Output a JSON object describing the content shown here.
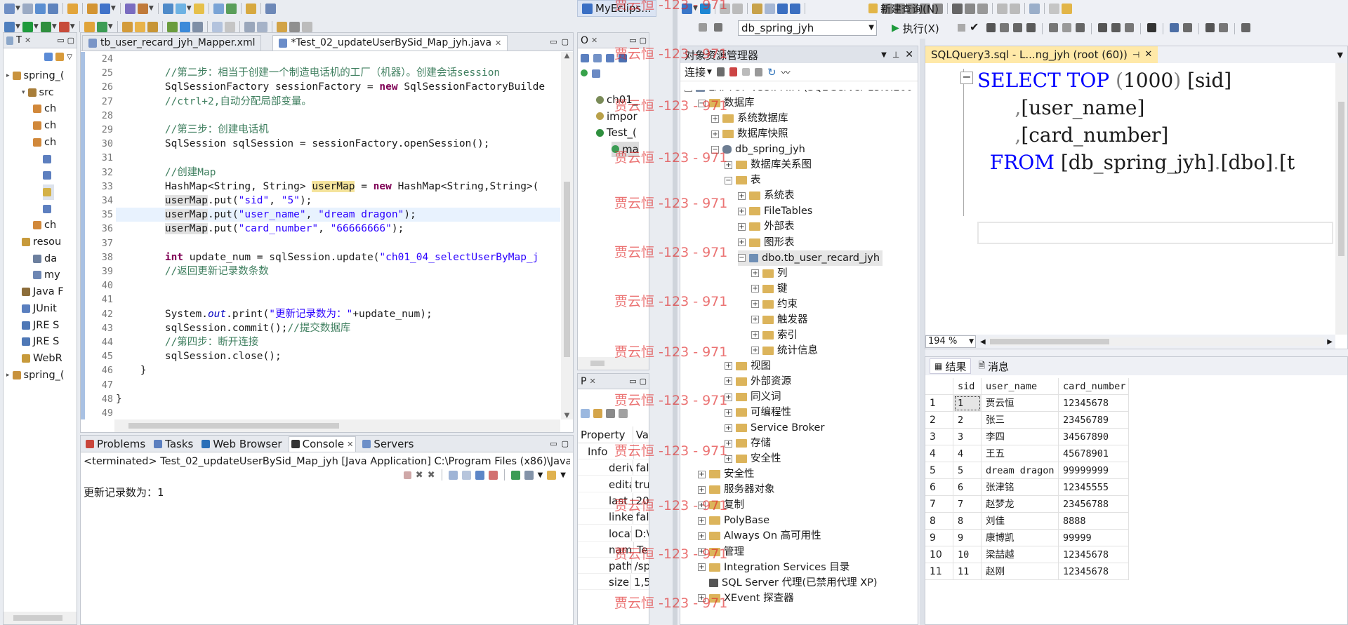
{
  "eclipse": {
    "perspective_label": "MyEclips...",
    "editor_tabs": [
      {
        "label": "tb_user_recard_jyh_Mapper.xml"
      },
      {
        "label": "*Test_02_updateUserBySid_Map_jyh.java"
      }
    ],
    "explorer_tab": "T",
    "explorer_items": [
      "spring_(",
      "src",
      "ch",
      "ch",
      "ch",
      "",
      "",
      "",
      "",
      "ch",
      "resou",
      "da",
      "my",
      "Java F",
      "JUnit",
      "JRE S",
      "JRE S",
      "WebR",
      "spring_("
    ],
    "outline_tab": "O",
    "outline_items": [
      "ch01_",
      "impor",
      "Test_(",
      "ma"
    ],
    "props_tab": "P",
    "props_header": {
      "k": "Property",
      "v": "Va"
    },
    "props_rows": [
      {
        "k": "Info",
        "v": ""
      },
      {
        "k": "deriv",
        "v": "fal"
      },
      {
        "k": "edita",
        "v": "tru"
      },
      {
        "k": "last r",
        "v": "20"
      },
      {
        "k": "linke",
        "v": "fal"
      },
      {
        "k": "locat",
        "v": "D:\\"
      },
      {
        "k": "nam",
        "v": "Te"
      },
      {
        "k": "path",
        "v": "/sp"
      },
      {
        "k": "size",
        "v": "1,5"
      }
    ],
    "code": {
      "line_numbers": [
        "24",
        "25",
        "26",
        "27",
        "28",
        "29",
        "30",
        "31",
        "32",
        "33",
        "34",
        "35",
        "36",
        "37",
        "38",
        "39",
        "40",
        "41",
        "42",
        "43",
        "44",
        "45",
        "46",
        "47",
        "48",
        "49"
      ],
      "lines": [
        [],
        [
          {
            "t": "        //第二步：相当于创建一个制造电话机的工厂（机器）。创建会话session",
            "c": "cm"
          }
        ],
        [
          {
            "t": "        SqlSessionFactory sessionFactory = ",
            "c": ""
          },
          {
            "t": "new",
            "c": "kw"
          },
          {
            "t": " SqlSessionFactoryBuilde",
            "c": ""
          }
        ],
        [
          {
            "t": "        //ctrl+2,自动分配局部变量。",
            "c": "cm"
          }
        ],
        [],
        [
          {
            "t": "        //第三步：创建电话机",
            "c": "cm"
          }
        ],
        [
          {
            "t": "        SqlSession sqlSession = sessionFactory.openSession();",
            "c": ""
          }
        ],
        [],
        [
          {
            "t": "        //创建Map",
            "c": "cm"
          }
        ],
        [
          {
            "t": "        HashMap<String, String> ",
            "c": ""
          },
          {
            "t": "userMap",
            "c": "hl"
          },
          {
            "t": " = ",
            "c": ""
          },
          {
            "t": "new",
            "c": "kw"
          },
          {
            "t": " HashMap<String,String>(",
            "c": ""
          }
        ],
        [
          {
            "t": "        ",
            "c": ""
          },
          {
            "t": "userMap",
            "c": "hl2"
          },
          {
            "t": ".put(",
            "c": ""
          },
          {
            "t": "\"sid\"",
            "c": "str"
          },
          {
            "t": ", ",
            "c": ""
          },
          {
            "t": "\"5\"",
            "c": "str"
          },
          {
            "t": ");",
            "c": ""
          }
        ],
        [
          {
            "t": "        ",
            "c": ""
          },
          {
            "t": "userMap",
            "c": "hl2"
          },
          {
            "t": ".put(",
            "c": ""
          },
          {
            "t": "\"user_name\"",
            "c": "str"
          },
          {
            "t": ", ",
            "c": ""
          },
          {
            "t": "\"dream dragon\"",
            "c": "str"
          },
          {
            "t": ");",
            "c": ""
          }
        ],
        [
          {
            "t": "        ",
            "c": ""
          },
          {
            "t": "userMap",
            "c": "hl2"
          },
          {
            "t": ".put(",
            "c": ""
          },
          {
            "t": "\"card_number\"",
            "c": "str"
          },
          {
            "t": ", ",
            "c": ""
          },
          {
            "t": "\"66666666\"",
            "c": "str"
          },
          {
            "t": ");",
            "c": ""
          }
        ],
        [],
        [
          {
            "t": "        ",
            "c": ""
          },
          {
            "t": "int",
            "c": "kw"
          },
          {
            "t": " update_num = sqlSession.update(",
            "c": ""
          },
          {
            "t": "\"ch01_04_selectUserByMap_j",
            "c": "str"
          }
        ],
        [
          {
            "t": "        //返回更新记录数条数",
            "c": "cm"
          }
        ],
        [],
        [],
        [
          {
            "t": "        System.",
            "c": ""
          },
          {
            "t": "out",
            "c": "it"
          },
          {
            "t": ".print(",
            "c": ""
          },
          {
            "t": "\"更新记录数为：\"",
            "c": "str"
          },
          {
            "t": "+update_num);",
            "c": ""
          }
        ],
        [
          {
            "t": "        sqlSession.commit();",
            "c": ""
          },
          {
            "t": "//提交数据库",
            "c": "cm"
          }
        ],
        [
          {
            "t": "        //第四步：断开连接",
            "c": "cm"
          }
        ],
        [
          {
            "t": "        sqlSession.close();",
            "c": ""
          }
        ],
        [
          {
            "t": "    }",
            "c": ""
          }
        ],
        [],
        [
          {
            "t": "}",
            "c": ""
          }
        ],
        []
      ]
    },
    "bottom_tabs": [
      "Problems",
      "Tasks",
      "Web Browser",
      "Console",
      "Servers"
    ],
    "console_header": "<terminated> Test_02_updateUserBySid_Map_jyh [Java Application] C:\\Program Files (x86)\\Java\\",
    "console_output": "更新记录数为：1"
  },
  "ssms": {
    "db_combo": "db_spring_jyh",
    "execute_label": "执行(X)",
    "new_query_label": "新建查询(N)",
    "explorer_title": "对象资源管理器",
    "connect_label": "连接",
    "query_tab": "SQLQuery3.sql - L...ng_jyh (root (60))",
    "tree": [
      {
        "label": "LAPTOP-V55IPMIM (SQL Server 15.0.200",
        "lvl": 0,
        "sign": "−",
        "icon": "server"
      },
      {
        "label": "数据库",
        "lvl": 1,
        "sign": "−",
        "icon": "folder"
      },
      {
        "label": "系统数据库",
        "lvl": 2,
        "sign": "+",
        "icon": "folder"
      },
      {
        "label": "数据库快照",
        "lvl": 2,
        "sign": "+",
        "icon": "folder"
      },
      {
        "label": "db_spring_jyh",
        "lvl": 2,
        "sign": "−",
        "icon": "db"
      },
      {
        "label": "数据库关系图",
        "lvl": 3,
        "sign": "+",
        "icon": "folder"
      },
      {
        "label": "表",
        "lvl": 3,
        "sign": "−",
        "icon": "folder"
      },
      {
        "label": "系统表",
        "lvl": 4,
        "sign": "+",
        "icon": "folder"
      },
      {
        "label": "FileTables",
        "lvl": 4,
        "sign": "+",
        "icon": "folder"
      },
      {
        "label": "外部表",
        "lvl": 4,
        "sign": "+",
        "icon": "folder"
      },
      {
        "label": "图形表",
        "lvl": 4,
        "sign": "+",
        "icon": "folder"
      },
      {
        "label": "dbo.tb_user_recard_jyh",
        "lvl": 4,
        "sign": "−",
        "icon": "table"
      },
      {
        "label": "列",
        "lvl": 5,
        "sign": "+",
        "icon": "folder"
      },
      {
        "label": "键",
        "lvl": 5,
        "sign": "+",
        "icon": "folder"
      },
      {
        "label": "约束",
        "lvl": 5,
        "sign": "+",
        "icon": "folder"
      },
      {
        "label": "触发器",
        "lvl": 5,
        "sign": "+",
        "icon": "folder"
      },
      {
        "label": "索引",
        "lvl": 5,
        "sign": "+",
        "icon": "folder"
      },
      {
        "label": "统计信息",
        "lvl": 5,
        "sign": "+",
        "icon": "folder"
      },
      {
        "label": "视图",
        "lvl": 3,
        "sign": "+",
        "icon": "folder"
      },
      {
        "label": "外部资源",
        "lvl": 3,
        "sign": "+",
        "icon": "folder"
      },
      {
        "label": "同义词",
        "lvl": 3,
        "sign": "+",
        "icon": "folder"
      },
      {
        "label": "可编程性",
        "lvl": 3,
        "sign": "+",
        "icon": "folder"
      },
      {
        "label": "Service Broker",
        "lvl": 3,
        "sign": "+",
        "icon": "folder"
      },
      {
        "label": "存储",
        "lvl": 3,
        "sign": "+",
        "icon": "folder"
      },
      {
        "label": "安全性",
        "lvl": 3,
        "sign": "+",
        "icon": "folder"
      },
      {
        "label": "安全性",
        "lvl": 1,
        "sign": "+",
        "icon": "folder"
      },
      {
        "label": "服务器对象",
        "lvl": 1,
        "sign": "+",
        "icon": "folder"
      },
      {
        "label": "复制",
        "lvl": 1,
        "sign": "+",
        "icon": "folder"
      },
      {
        "label": "PolyBase",
        "lvl": 1,
        "sign": "+",
        "icon": "folder"
      },
      {
        "label": "Always On 高可用性",
        "lvl": 1,
        "sign": "+",
        "icon": "folder"
      },
      {
        "label": "管理",
        "lvl": 1,
        "sign": "+",
        "icon": "folder"
      },
      {
        "label": "Integration Services 目录",
        "lvl": 1,
        "sign": "+",
        "icon": "folder"
      },
      {
        "label": "SQL Server 代理(已禁用代理 XP)",
        "lvl": 1,
        "sign": "",
        "icon": "agent"
      },
      {
        "label": "XEvent 探查器",
        "lvl": 1,
        "sign": "+",
        "icon": "folder"
      }
    ],
    "sql_lines": [
      [
        {
          "t": "SELECT TOP ",
          "c": "sqlkw"
        },
        {
          "t": "(",
          "c": "sqlg"
        },
        {
          "t": "1000",
          "c": ""
        },
        {
          "t": ")",
          "c": "sqlg"
        },
        {
          "t": " [sid]",
          "c": ""
        }
      ],
      [
        {
          "t": "      ,",
          "c": "sqlg"
        },
        {
          "t": "[user_name]",
          "c": ""
        }
      ],
      [
        {
          "t": "      ,",
          "c": "sqlg"
        },
        {
          "t": "[card_number]",
          "c": ""
        }
      ],
      [
        {
          "t": "  FROM ",
          "c": "sqlkw"
        },
        {
          "t": "[db_spring_jyh]",
          "c": ""
        },
        {
          "t": ".",
          "c": "sqlg"
        },
        {
          "t": "[dbo]",
          "c": ""
        },
        {
          "t": ".",
          "c": "sqlg"
        },
        {
          "t": "[t",
          "c": ""
        }
      ]
    ],
    "zoom": "194 %",
    "result_tabs": [
      "结果",
      "消息"
    ],
    "grid": {
      "columns": [
        "sid",
        "user_name",
        "card_number"
      ],
      "rows": [
        [
          "1",
          "贾云恒",
          "12345678"
        ],
        [
          "2",
          "张三",
          "23456789"
        ],
        [
          "3",
          "李四",
          "34567890"
        ],
        [
          "4",
          "王五",
          "45678901"
        ],
        [
          "5",
          "dream dragon",
          "99999999"
        ],
        [
          "6",
          "张津铭",
          "12345555"
        ],
        [
          "7",
          "赵梦龙",
          "23456788"
        ],
        [
          "8",
          "刘佳",
          "8888"
        ],
        [
          "9",
          "康博凯",
          "99999"
        ],
        [
          "10",
          "梁喆越",
          "12345678"
        ],
        [
          "11",
          "赵刚",
          "12345678"
        ]
      ]
    }
  },
  "watermark": "贾云恒 -123 - 971"
}
